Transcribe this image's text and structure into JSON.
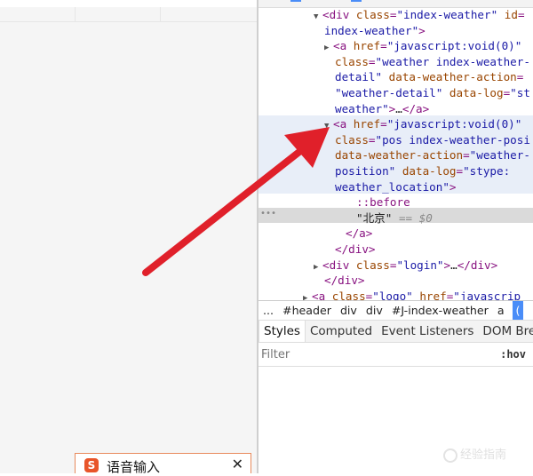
{
  "ime": {
    "logo": "S",
    "label": "语音输入",
    "close": "✕"
  },
  "elements": {
    "lines": [
      {
        "parts": [
          [
            "tri",
            "▼"
          ],
          [
            "tag",
            "<div "
          ],
          [
            "attr",
            "class"
          ],
          [
            "tag",
            "="
          ],
          [
            "val",
            "\"index-weather\" "
          ],
          [
            "attr",
            "id"
          ],
          [
            "tag",
            "="
          ]
        ]
      },
      {
        "parts": [
          [
            "val",
            "index-weather\""
          ],
          [
            "tag",
            ">"
          ]
        ]
      },
      {
        "parts": [
          [
            "tri",
            "▶"
          ],
          [
            "tag",
            "<a "
          ],
          [
            "attr",
            "href"
          ],
          [
            "tag",
            "="
          ],
          [
            "val",
            "\"javascript:void(0)\""
          ]
        ]
      },
      {
        "parts": [
          [
            "attr",
            "class"
          ],
          [
            "tag",
            "="
          ],
          [
            "val",
            "\"weather index-weather-"
          ]
        ]
      },
      {
        "parts": [
          [
            "val",
            "detail\" "
          ],
          [
            "attr",
            "data-weather-action"
          ],
          [
            "tag",
            "="
          ]
        ]
      },
      {
        "parts": [
          [
            "val",
            "\"weather-detail\" "
          ],
          [
            "attr",
            "data-log"
          ],
          [
            "tag",
            "="
          ],
          [
            "val",
            "\"st"
          ]
        ]
      },
      {
        "parts": [
          [
            "val",
            "weather\""
          ],
          [
            "tag",
            ">"
          ],
          [
            "txt",
            "…"
          ],
          [
            "tag",
            "</a>"
          ]
        ]
      },
      {
        "parts": [
          [
            "tri",
            "▼"
          ],
          [
            "tag",
            "<a "
          ],
          [
            "attr",
            "href"
          ],
          [
            "tag",
            "="
          ],
          [
            "val",
            "\"javascript:void(0)\""
          ]
        ]
      },
      {
        "parts": [
          [
            "attr",
            "class"
          ],
          [
            "tag",
            "="
          ],
          [
            "val",
            "\"pos index-weather-posi"
          ]
        ]
      },
      {
        "parts": [
          [
            "attr",
            "data-weather-action"
          ],
          [
            "tag",
            "="
          ],
          [
            "val",
            "\"weather-"
          ]
        ]
      },
      {
        "parts": [
          [
            "val",
            "position\" "
          ],
          [
            "attr",
            "data-log"
          ],
          [
            "tag",
            "="
          ],
          [
            "val",
            "\"stype:"
          ]
        ]
      },
      {
        "parts": [
          [
            "val",
            "weather_location\""
          ],
          [
            "tag",
            ">"
          ]
        ]
      },
      {
        "parts": [
          [
            "pseudo",
            "::before"
          ]
        ]
      },
      {
        "parts": [
          [
            "txt",
            "\"北京\""
          ],
          [
            "dollar",
            " == $0"
          ]
        ]
      },
      {
        "parts": [
          [
            "tag",
            "</a>"
          ]
        ]
      },
      {
        "parts": [
          [
            "tag",
            "</div>"
          ]
        ]
      },
      {
        "parts": [
          [
            "tri",
            "▶"
          ],
          [
            "tag",
            "<div "
          ],
          [
            "attr",
            "class"
          ],
          [
            "tag",
            "="
          ],
          [
            "val",
            "\"login\""
          ],
          [
            "tag",
            ">"
          ],
          [
            "txt",
            "…"
          ],
          [
            "tag",
            "</div>"
          ]
        ]
      },
      {
        "parts": [
          [
            "tag",
            "</div>"
          ]
        ]
      },
      {
        "parts": [
          [
            "tri",
            "▶"
          ],
          [
            "tag",
            "<a "
          ],
          [
            "attr",
            "class"
          ],
          [
            "tag",
            "="
          ],
          [
            "val",
            "\"logo\" "
          ],
          [
            "attr",
            "href"
          ],
          [
            "tag",
            "="
          ],
          [
            "val",
            "\"javascrip"
          ]
        ]
      }
    ],
    "ellipsis": "•••"
  },
  "breadcrumb": {
    "items": [
      "...",
      "#header",
      "div",
      "div",
      "#J-index-weather",
      "a"
    ],
    "active": "("
  },
  "styles_tabs": {
    "items": [
      "Styles",
      "Computed",
      "Event Listeners",
      "DOM Breakp"
    ]
  },
  "filter": {
    "placeholder": "Filter",
    "hov": ":hov"
  },
  "watermark": "经验指南",
  "colors": {
    "arrow": "#e0202a",
    "selection": "#4a8df8",
    "highlight": "#e8eef8"
  }
}
